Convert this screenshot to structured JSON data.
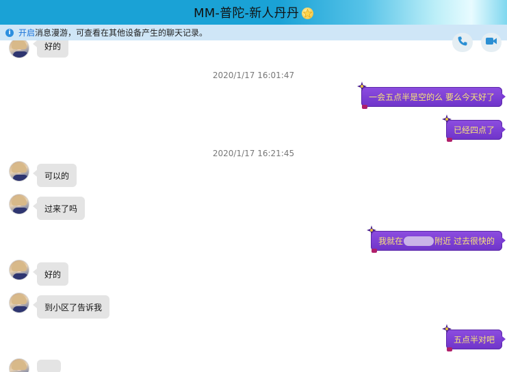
{
  "window": {
    "title": "MM-普陀-新人丹丹"
  },
  "info_bar": {
    "link": "开启",
    "message": "消息漫游，可查看在其他设备产生的聊天记录。"
  },
  "chat": {
    "partial_top_message": "好的",
    "timestamps": [
      "2020/1/17 16:01:47",
      "2020/1/17 16:21:45"
    ],
    "outgoing": [
      "一会五点半是空的么 要么今天好了",
      "已经四点了",
      "五点半对吧"
    ],
    "outgoing_redacted": {
      "before": "我就在",
      "after": "附近 过去很快的"
    },
    "incoming": [
      "可以的",
      "过来了吗",
      "好的",
      "到小区了告诉我"
    ]
  },
  "colors": {
    "title_bar": "#1aa2d6",
    "info_bar": "#cfe6f7",
    "outgoing_bubble": "#7a3cd4",
    "outgoing_text": "#f7e27a",
    "incoming_bubble": "#e4e4e4"
  }
}
